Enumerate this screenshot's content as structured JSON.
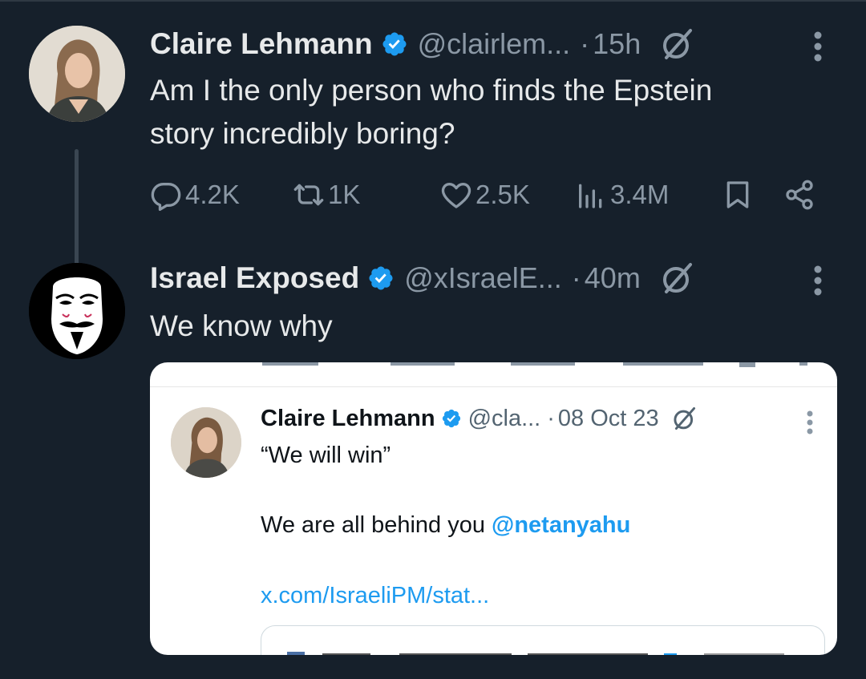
{
  "tweet1": {
    "name": "Claire Lehmann",
    "handle": "@clairlem...",
    "dot": "·",
    "time": "15h",
    "text_line1": "Am I the only person who finds the Epstein",
    "text_line2": "story incredibly boring?",
    "stats": {
      "replies": "4.2K",
      "reposts": "1K",
      "likes": "2.5K",
      "views": "3.4M"
    }
  },
  "tweet2": {
    "name": "Israel Exposed",
    "handle": "@xIsraelE...",
    "dot": "·",
    "time": "40m",
    "text": "We know why"
  },
  "embedded": {
    "name": "Claire Lehmann",
    "handle": "@cla...",
    "dot": "·",
    "date": "08 Oct 23",
    "line1": "“We will win”",
    "line2_prefix": "We are all behind you ",
    "line2_mention": "@netanyahu",
    "link": "x.com/IsraeliPM/stat..."
  },
  "colors": {
    "background": "#16202b",
    "text_primary": "#e7e9ea",
    "text_secondary": "#8b98a5",
    "verified_blue": "#1d9bf0",
    "card_background": "#ffffff"
  },
  "icons": [
    "verified-badge-icon",
    "grok-icon",
    "more-icon",
    "reply-icon",
    "repost-icon",
    "like-icon",
    "views-icon",
    "bookmark-icon",
    "share-icon"
  ]
}
